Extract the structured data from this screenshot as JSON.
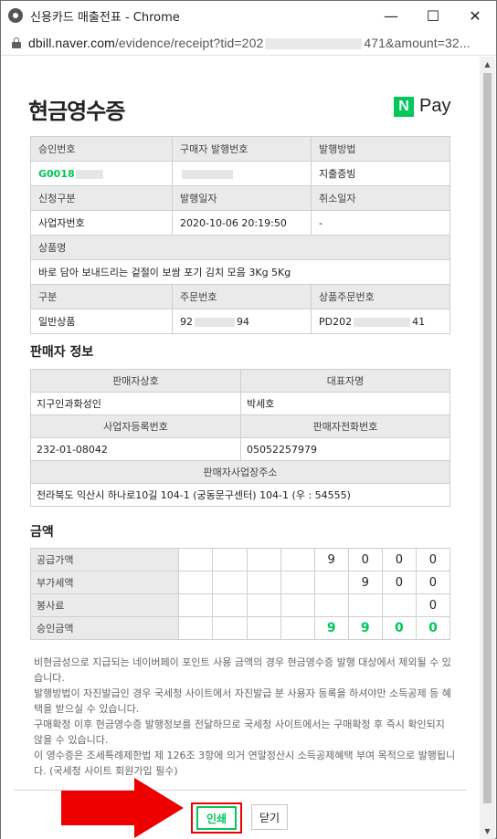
{
  "window": {
    "title": "신용카드 매출전표 - Chrome",
    "minimize": "—",
    "maximize": "☐",
    "close": "✕"
  },
  "address": {
    "host": "dbill.naver.com",
    "path_start": "/evidence/receipt?tid=202",
    "path_end": "471&amount=32..."
  },
  "receipt": {
    "title": "현금영수증",
    "brand_badge": "N",
    "brand_text": "Pay",
    "info": {
      "h_approval": "승인번호",
      "h_issuer": "구매자 발행번호",
      "h_method": "발행방법",
      "approval": "G0018",
      "method": "지출증빙",
      "h_request": "신청구분",
      "h_date": "발행일자",
      "h_cancel": "취소일자",
      "request": "사업자번호",
      "date": "2020-10-06 20:19:50",
      "cancel": "-",
      "h_product": "상품명",
      "product": "바로 담아 보내드리는 겉절이 보쌈 포기 김치 모음 3Kg 5Kg",
      "h_type": "구분",
      "h_order": "주문번호",
      "h_product_order": "상품주문번호",
      "type": "일반상품",
      "order_start": "92",
      "order_end": "94",
      "product_order_start": "PD202",
      "product_order_end": "41"
    },
    "seller": {
      "section": "판매자 정보",
      "h_name": "판매자상호",
      "h_rep": "대표자명",
      "name": "지구인과화성인",
      "rep": "박세호",
      "h_bizno": "사업자등록번호",
      "h_phone": "판매자전화번호",
      "bizno": "232-01-08042",
      "phone": "05052257979",
      "h_address": "판매자사업장주소",
      "address": "전라북도 익산시 하나로10길 104-1 (궁동문구센터) 104-1 (우 : 54555)"
    },
    "amount": {
      "section": "금액",
      "rows": [
        {
          "label": "공급가액",
          "digits": [
            "",
            "",
            "",
            "",
            "9",
            "0",
            "0",
            "0"
          ]
        },
        {
          "label": "부가세액",
          "digits": [
            "",
            "",
            "",
            "",
            "",
            "9",
            "0",
            "0"
          ]
        },
        {
          "label": "봉사료",
          "digits": [
            "",
            "",
            "",
            "",
            "",
            "",
            "",
            "0"
          ]
        },
        {
          "label": "승인금액",
          "digits": [
            "",
            "",
            "",
            "",
            "9",
            "9",
            "0",
            "0"
          ]
        }
      ]
    },
    "notes": [
      "비현금성으로 지급되는 네이버페이 포인트 사용 금액의 경우 현금영수증 발행 대상에서 제외될 수 있습니다.",
      "발행방법이 자진발급인 경우 국세청 사이트에서 자진발급 분 사용자 등록을 하셔야만 소득공제 등 혜택을 받으실 수 있습니다.",
      "구매확정 이후 현금영수증 발행정보를 전달하므로 국세청 사이트에서는 구매확정 후 즉시 확인되지 않을 수 있습니다.",
      "이 영수증은 조세특례제한법 제 126조 3항에 의거 연말정산시 소득공제혜택 부여 목적으로 발행됩니다. (국세청 사이트 회원가입 필수)"
    ],
    "buttons": {
      "print": "인쇄",
      "close": "닫기"
    }
  },
  "colors": {
    "accent_green": "#03c75a",
    "highlight_red": "#ee0000"
  }
}
